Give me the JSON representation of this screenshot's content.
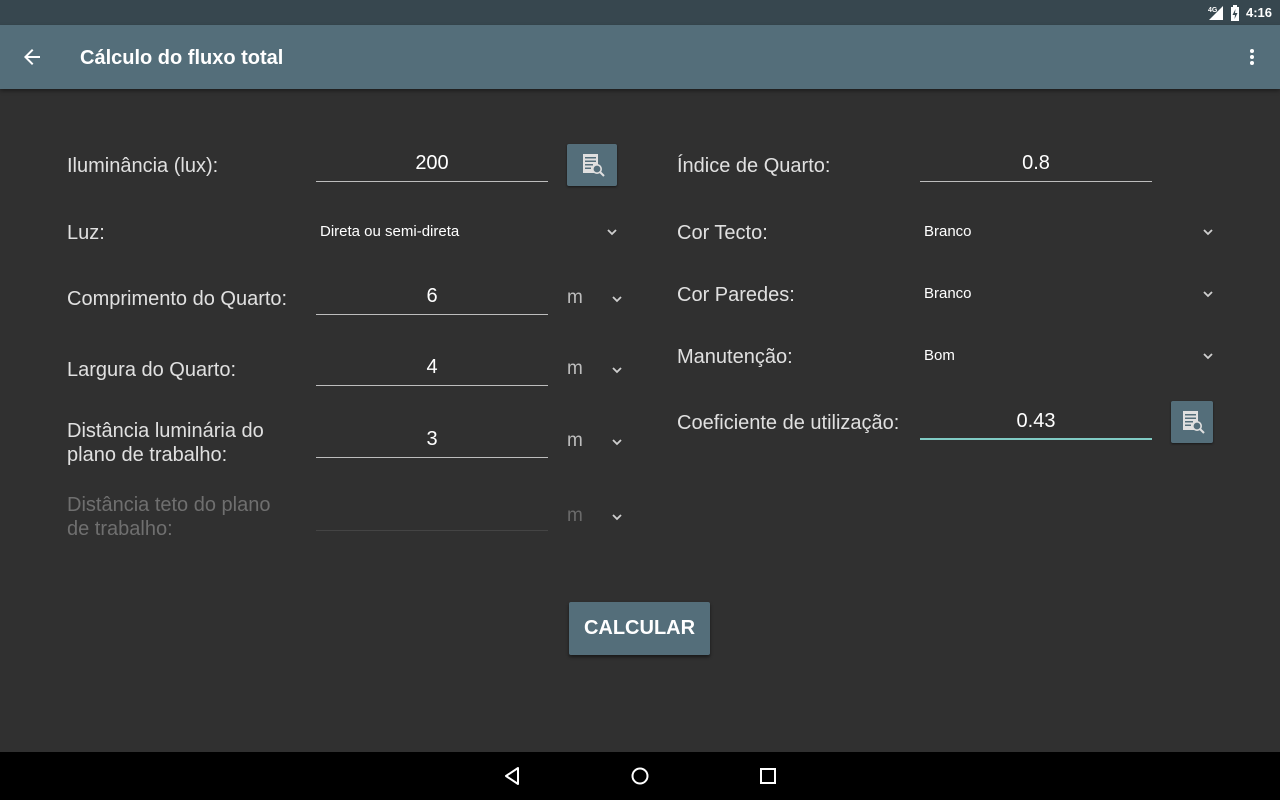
{
  "status_bar": {
    "network": "4G",
    "time": "4:16"
  },
  "app_bar": {
    "title": "Cálculo do fluxo total",
    "back_icon": "arrow-back-icon",
    "menu_icon": "more-vert-icon"
  },
  "left_form": {
    "illuminance": {
      "label": "Iluminância (lux):",
      "value": "200"
    },
    "light": {
      "label": "Luz:",
      "selected": "Direta ou semi-direta"
    },
    "room_length": {
      "label": "Comprimento do Quarto:",
      "value": "6",
      "unit": "m"
    },
    "room_width": {
      "label": "Largura do Quarto:",
      "value": "4",
      "unit": "m"
    },
    "luminaire_distance": {
      "label_line1": "Distância luminária do",
      "label_line2": "plano de trabalho:",
      "value": "3",
      "unit": "m"
    },
    "ceiling_distance": {
      "label_line1": "Distância teto do plano",
      "label_line2": "de trabalho:",
      "value": "",
      "unit": "m",
      "enabled": false
    }
  },
  "right_form": {
    "room_index": {
      "label": "Índice de Quarto:",
      "value": "0.8"
    },
    "ceiling_color": {
      "label": "Cor Tecto:",
      "selected": "Branco"
    },
    "wall_color": {
      "label": "Cor Paredes:",
      "selected": "Branco"
    },
    "maintenance": {
      "label": "Manutenção:",
      "selected": "Bom"
    },
    "utilization": {
      "label": "Coeficiente de utilização:",
      "value": "0.43"
    }
  },
  "actions": {
    "calculate": "CALCULAR"
  },
  "colors": {
    "background": "#303030",
    "app_bar": "#546e7a",
    "status_bar": "#37474f",
    "focus_accent": "#80cbc4",
    "nav_bar": "#000000"
  }
}
